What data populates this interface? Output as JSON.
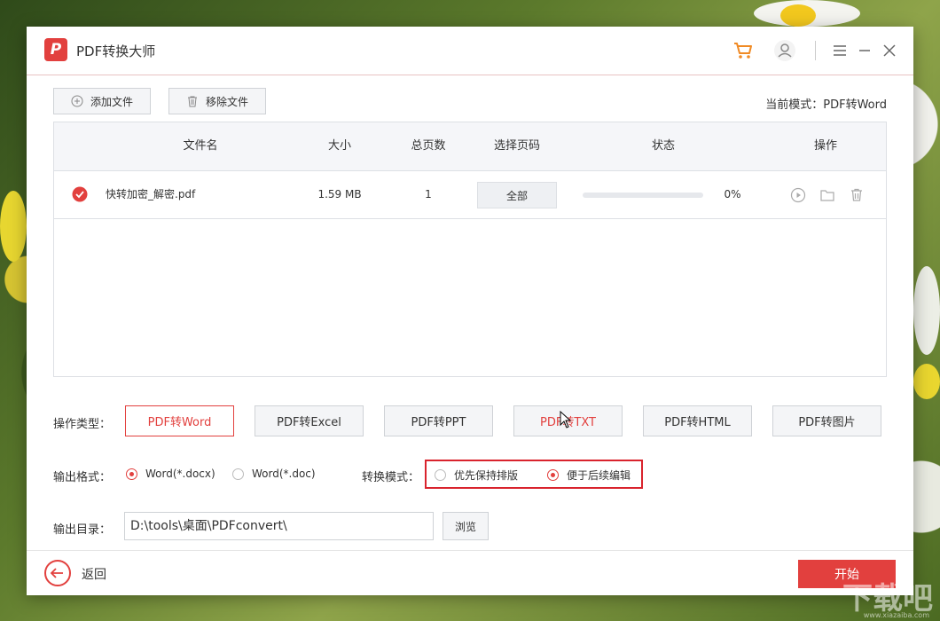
{
  "app": {
    "title": "PDF转换大师",
    "logo_letter": "P"
  },
  "toolbar": {
    "add_file": "添加文件",
    "remove_file": "移除文件",
    "current_mode": "当前模式：PDF转Word"
  },
  "table": {
    "headers": [
      "文件名",
      "大小",
      "总页数",
      "选择页码",
      "状态",
      "操作"
    ],
    "rows": [
      {
        "name": "快转加密_解密.pdf",
        "size": "1.59 MB",
        "pages": "1",
        "page_select": "全部",
        "progress": 0,
        "progress_text": "0%"
      }
    ]
  },
  "operation": {
    "label": "操作类型：",
    "types": [
      "PDF转Word",
      "PDF转Excel",
      "PDF转PPT",
      "PDF转TXT",
      "PDF转HTML",
      "PDF转图片"
    ],
    "active_index": 0
  },
  "output_format": {
    "label": "输出格式：",
    "options": [
      "Word(*.docx)",
      "Word(*.doc)"
    ],
    "selected": 0
  },
  "convert_mode": {
    "label": "转换模式：",
    "options": [
      "优先保持排版",
      "便于后续编辑"
    ],
    "selected": 1
  },
  "output_dir": {
    "label": "输出目录：",
    "value": "D:\\tools\\桌面\\PDFconvert\\",
    "browse": "浏览"
  },
  "footer": {
    "back": "返回",
    "start": "开始"
  },
  "watermark": {
    "text": "下载吧",
    "small": "www.xiazaiba.com"
  },
  "colors": {
    "accent": "#e2403e",
    "highlight": "#d9232d"
  }
}
